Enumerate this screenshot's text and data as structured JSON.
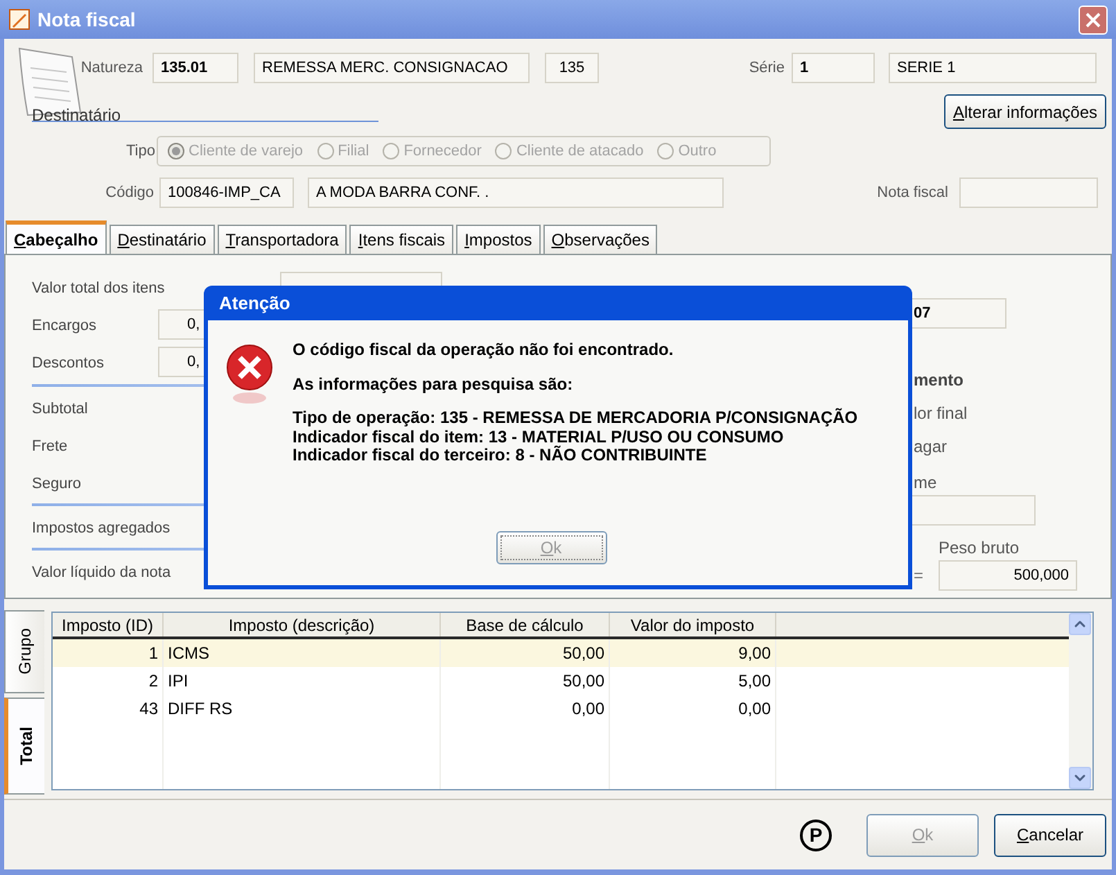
{
  "window": {
    "title": "Nota fiscal"
  },
  "header": {
    "natureza": {
      "label": "Natureza",
      "code": "135.01",
      "description": "REMESSA MERC. CONSIGNACAO",
      "number": "135"
    },
    "serie": {
      "label": "Série",
      "code": "1",
      "name": "SERIE 1"
    },
    "section_label": "Destinatário",
    "alter_button": "Alterar informações",
    "tipo": {
      "label": "Tipo",
      "disabled": true,
      "options": [
        {
          "label": "Cliente de varejo",
          "selected": true
        },
        {
          "label": "Filial",
          "selected": false
        },
        {
          "label": "Fornecedor",
          "selected": false
        },
        {
          "label": "Cliente de atacado",
          "selected": false
        },
        {
          "label": "Outro",
          "selected": false
        }
      ]
    },
    "codigo": {
      "label": "Código",
      "code": "100846-IMP_CA",
      "name": "A MODA BARRA CONF. ."
    },
    "nota_fiscal": {
      "label": "Nota fiscal"
    }
  },
  "tabs": [
    {
      "label": "Cabeçalho",
      "selected": true
    },
    {
      "label": "Destinatário",
      "selected": false
    },
    {
      "label": "Transportadora",
      "selected": false
    },
    {
      "label": "Itens fiscais",
      "selected": false
    },
    {
      "label": "Impostos",
      "selected": false
    },
    {
      "label": "Observações",
      "selected": false
    }
  ],
  "summary_groups": [
    [
      {
        "kind": "wide-field",
        "label": "Valor total dos itens"
      },
      {
        "kind": "field",
        "label": "Encargos",
        "value": "0,"
      },
      {
        "kind": "field",
        "label": "Descontos",
        "value": "0,"
      }
    ],
    [
      {
        "kind": "label",
        "label": "Subtotal"
      },
      {
        "kind": "label",
        "label": "Frete"
      },
      {
        "kind": "label",
        "label": "Seguro"
      }
    ],
    [
      {
        "kind": "label",
        "label": "Impostos agregados"
      }
    ],
    [
      {
        "kind": "label",
        "label": "Valor líquido da nota"
      }
    ]
  ],
  "right_column": [
    {
      "kind": "field",
      "text": "07"
    },
    {
      "kind": "heading",
      "text": "mento"
    },
    {
      "kind": "text",
      "text": "lor final"
    },
    {
      "kind": "text",
      "text": "agar"
    },
    {
      "kind": "text",
      "text": "me"
    },
    {
      "kind": "empty-field"
    }
  ],
  "peso_bruto": {
    "sign": "=",
    "label": "Peso bruto",
    "value": "500,000"
  },
  "side_tabs": [
    {
      "label": "Grupo",
      "selected": false
    },
    {
      "label": "Total",
      "selected": true
    }
  ],
  "table": {
    "columns": [
      "Imposto (ID)",
      "Imposto (descrição)",
      "Base de cálculo",
      "Valor do imposto"
    ],
    "rows": [
      {
        "cells": [
          "1",
          "ICMS",
          "50,00",
          "9,00"
        ],
        "selected": true
      },
      {
        "cells": [
          "2",
          "IPI",
          "50,00",
          "5,00"
        ],
        "selected": false
      },
      {
        "cells": [
          "43",
          "DIFF RS",
          "0,00",
          "0,00"
        ],
        "selected": false
      }
    ]
  },
  "footer": {
    "badge": "P",
    "buttons": [
      {
        "label": "Ok",
        "disabled": true
      },
      {
        "label": "Cancelar",
        "disabled": false
      }
    ]
  },
  "dialog": {
    "title": "Atenção",
    "paragraphs": [
      [
        "O código fiscal da operação não foi encontrado."
      ],
      [
        "As informações para pesquisa são:"
      ],
      [
        "Tipo de operação: 135 - REMESSA DE MERCADORIA P/CONSIGNAÇÃO",
        "Indicador fiscal do item: 13 - MATERIAL P/USO OU CONSUMO",
        "Indicador fiscal do terceiro: 8 - NÃO CONTRIBUINTE"
      ]
    ],
    "button": {
      "label": "Ok",
      "disabled": true
    }
  }
}
